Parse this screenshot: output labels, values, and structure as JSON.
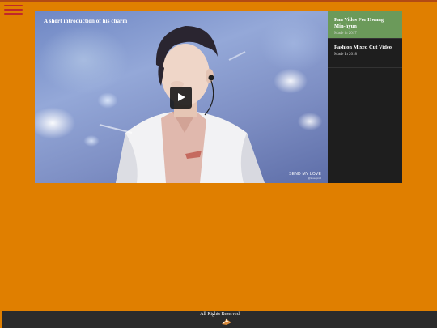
{
  "navigation": {
    "menu_icon": "hamburger-menu-icon"
  },
  "player": {
    "video_title": "A short introduction of his charm",
    "play_icon": "play-icon",
    "watermark_line1": "SEND MY LOVE",
    "watermark_line2": "@loveeprod"
  },
  "playlist": {
    "items": [
      {
        "title": "Fan Vidos For Hwang Min-hyun",
        "meta": "Made in 2017",
        "active": true
      },
      {
        "title": "Fashion Mixed Cut Video",
        "meta": "Made In 2018",
        "active": false
      }
    ]
  },
  "footer": {
    "text": "All Rights Reserved",
    "logo_icon": "site-logo-icon"
  },
  "colors": {
    "background": "#e07f00",
    "menu_icon": "#c0282a",
    "playlist_active": "#6b9a5a",
    "playlist_bg": "#1e1e1e",
    "footer_bg": "#2b2b2b"
  }
}
